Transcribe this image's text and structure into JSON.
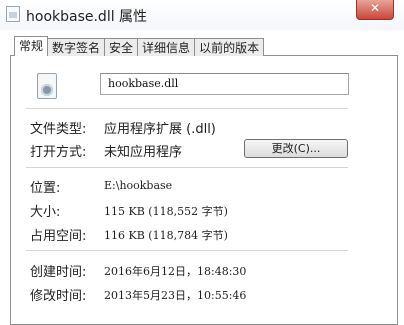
{
  "window": {
    "title": "hookbase.dll 属性",
    "close_glyph": "✕"
  },
  "tabs": [
    {
      "label": "常规",
      "active": true
    },
    {
      "label": "数字签名",
      "active": false
    },
    {
      "label": "安全",
      "active": false
    },
    {
      "label": "详细信息",
      "active": false
    },
    {
      "label": "以前的版本",
      "active": false
    }
  ],
  "general": {
    "file_name": "hookbase.dll",
    "file_type_label": "文件类型:",
    "file_type_value": "应用程序扩展 (.dll)",
    "opens_with_label": "打开方式:",
    "opens_with_value": "未知应用程序",
    "change_button": "更改(C)...",
    "location_label": "位置:",
    "location_value": "E:\\hookbase",
    "size_label": "大小:",
    "size_value": "115 KB (118,552 字节)",
    "size_on_disk_label": "占用空间:",
    "size_on_disk_value": "116 KB (118,784 字节)",
    "created_label": "创建时间:",
    "created_value": "2016年6月12日，18:48:30",
    "modified_label": "修改时间:",
    "modified_value": "2013年5月23日，10:55:46"
  }
}
